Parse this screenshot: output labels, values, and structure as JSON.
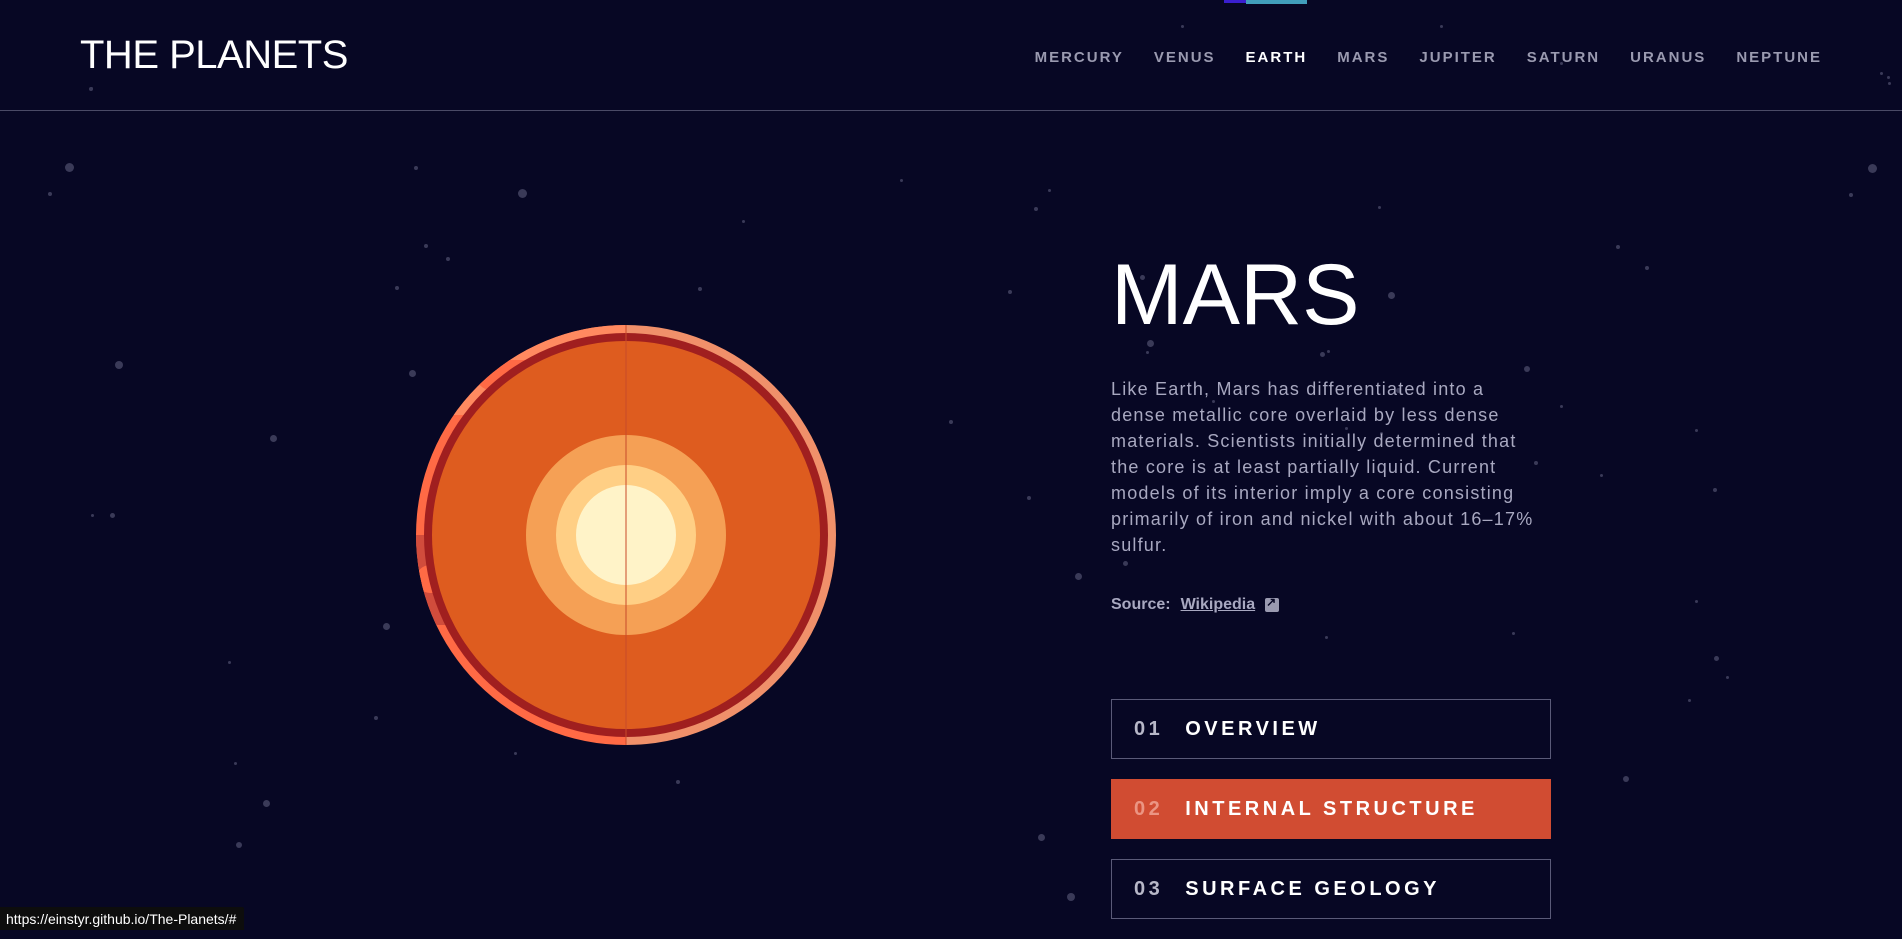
{
  "header": {
    "logo": "THE PLANETS",
    "nav": [
      "MERCURY",
      "VENUS",
      "EARTH",
      "MARS",
      "JUPITER",
      "SATURN",
      "URANUS",
      "NEPTUNE"
    ],
    "active_nav": "EARTH"
  },
  "planet": {
    "name": "MARS",
    "description": "Like Earth, Mars has differentiated into a dense metallic core overlaid by less dense materials. Scientists initially determined that the core is at least partially liquid. Current models of its interior imply a core consisting primarily of iron and nickel with about 16–17% sulfur.",
    "source_label": "Source:",
    "source_link": "Wikipedia",
    "image_icon": "mars-internal-structure-icon"
  },
  "tabs": [
    {
      "num": "01",
      "label": "OVERVIEW",
      "active": false
    },
    {
      "num": "02",
      "label": "INTERNAL STRUCTURE",
      "active": true
    },
    {
      "num": "03",
      "label": "SURFACE GEOLOGY",
      "active": false
    }
  ],
  "status_bar": {
    "url": "https://einstyr.github.io/The-Planets/#"
  },
  "colors": {
    "background": "#070724",
    "active_tab": "#d14c32",
    "mars_surface": "#ff6a45",
    "mars_mantle": "#de5c1f"
  }
}
